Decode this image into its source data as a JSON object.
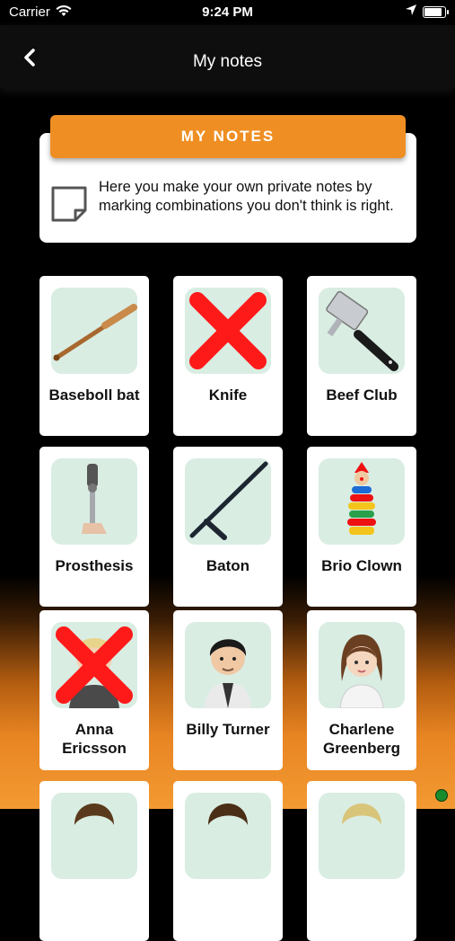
{
  "status_bar": {
    "carrier": "Carrier",
    "time": "9:24 PM"
  },
  "nav": {
    "title": "My notes",
    "back_icon": "chevron-left-icon"
  },
  "info": {
    "banner_label": "MY NOTES",
    "text": "Here you make your own private notes by marking combinations you don't think is right.",
    "icon": "note-icon"
  },
  "colors": {
    "accent": "#ef8f23",
    "tile_bg": "#d9ede3",
    "cross": "#ff1a1a"
  },
  "cards": [
    {
      "label": "Baseboll bat",
      "crossed": false
    },
    {
      "label": "Knife",
      "crossed": true
    },
    {
      "label": "Beef Club",
      "crossed": false
    },
    {
      "label": "Prosthesis",
      "crossed": false
    },
    {
      "label": "Baton",
      "crossed": false
    },
    {
      "label": "Brio Clown",
      "crossed": false
    },
    {
      "label": "Anna Ericsson",
      "crossed": true
    },
    {
      "label": "Billy Turner",
      "crossed": false
    },
    {
      "label": "Charlene Greenberg",
      "crossed": false
    }
  ]
}
